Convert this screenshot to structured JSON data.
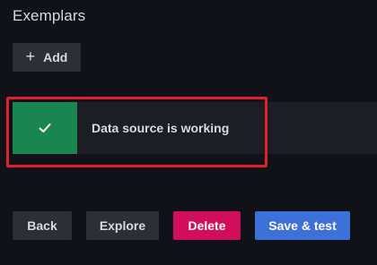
{
  "exemplars": {
    "title": "Exemplars",
    "add_label": "Add",
    "add_icon": "plus-icon"
  },
  "status": {
    "message": "Data source is working",
    "icon": "check-icon",
    "state_color": "#1b8552"
  },
  "highlight": {
    "color": "#e0202a"
  },
  "actions": {
    "back_label": "Back",
    "explore_label": "Explore",
    "delete_label": "Delete",
    "save_label": "Save & test",
    "delete_color": "#d10e5c",
    "save_color": "#3d71d9"
  }
}
